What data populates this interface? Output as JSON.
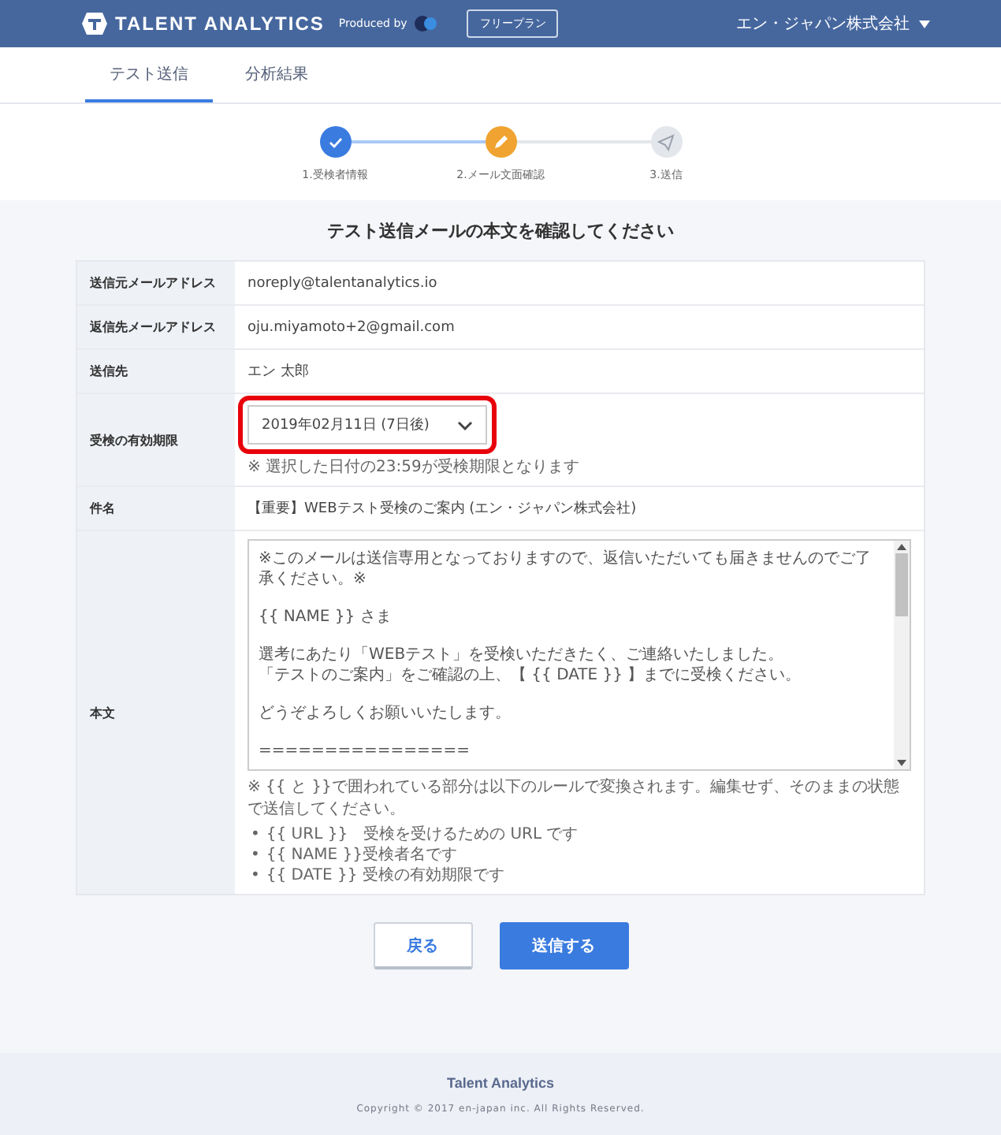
{
  "header": {
    "logo": "TALENT ANALYTICS",
    "produced_by": "Produced by",
    "plan_badge": "フリープラン",
    "company_menu": "エン・ジャパン株式会社"
  },
  "tabs": [
    {
      "label": "テスト送信",
      "selected": true
    },
    {
      "label": "分析結果",
      "selected": false
    }
  ],
  "steps": [
    {
      "label": "1.受検者情報",
      "kind": "done"
    },
    {
      "label": "2.メール文面確認",
      "kind": "current"
    },
    {
      "label": "3.送信",
      "kind": "pending"
    }
  ],
  "title": "テスト送信メールの本文を確認してください",
  "form": [
    {
      "kind": "text",
      "label": "送信元メールアドレス",
      "value": "noreply@talentanalytics.io"
    },
    {
      "kind": "text",
      "label": "返信先メールアドレス",
      "value": "oju.miyamoto+2@gmail.com"
    },
    {
      "kind": "text",
      "label": "送信先",
      "value": "エン 太郎"
    },
    {
      "kind": "select",
      "label": "受検の有効期限",
      "value": "2019年02月11日 (7日後)",
      "highlighted": true,
      "note": "※ 選択した日付の23:59が受検期限となります"
    },
    {
      "kind": "text",
      "label": "件名",
      "value": "【重要】WEBテスト受検のご案内 (エン・ジャパン株式会社)"
    },
    {
      "kind": "body",
      "label": "本文",
      "paragraphs": [
        [
          "※このメールは送信専用となっておりますので、返信いただいても届きませんのでご了承ください。※"
        ],
        [
          "{{ NAME }} さま"
        ],
        [
          "選考にあたり「WEBテスト」を受検いただきたく、ご連絡いたしました。",
          "「テストのご案内」をご確認の上、【 {{ DATE }} 】までに受検ください。"
        ],
        [
          "どうぞよろしくお願いいたします。"
        ],
        [
          "================"
        ]
      ],
      "note": "※ {{ と }}で囲われている部分は以下のルールで変換されます。編集せず、そのままの状態で送信してください。",
      "rules": [
        {
          "marker": "•",
          "text": "{{ URL }}　受検を受けるための URL です"
        },
        {
          "marker": "•",
          "text": "{{ NAME }}受検者名です"
        },
        {
          "marker": "•",
          "text": "{{ DATE }} 受検の有効期限です"
        }
      ]
    }
  ],
  "buttons": [
    {
      "label": "戻る",
      "kind": "secondary"
    },
    {
      "label": "送信する",
      "kind": "primary"
    }
  ],
  "footer": {
    "brand": "Talent Analytics",
    "copyright": "Copyright © 2017 en-japan inc. All Rights Reserved."
  }
}
